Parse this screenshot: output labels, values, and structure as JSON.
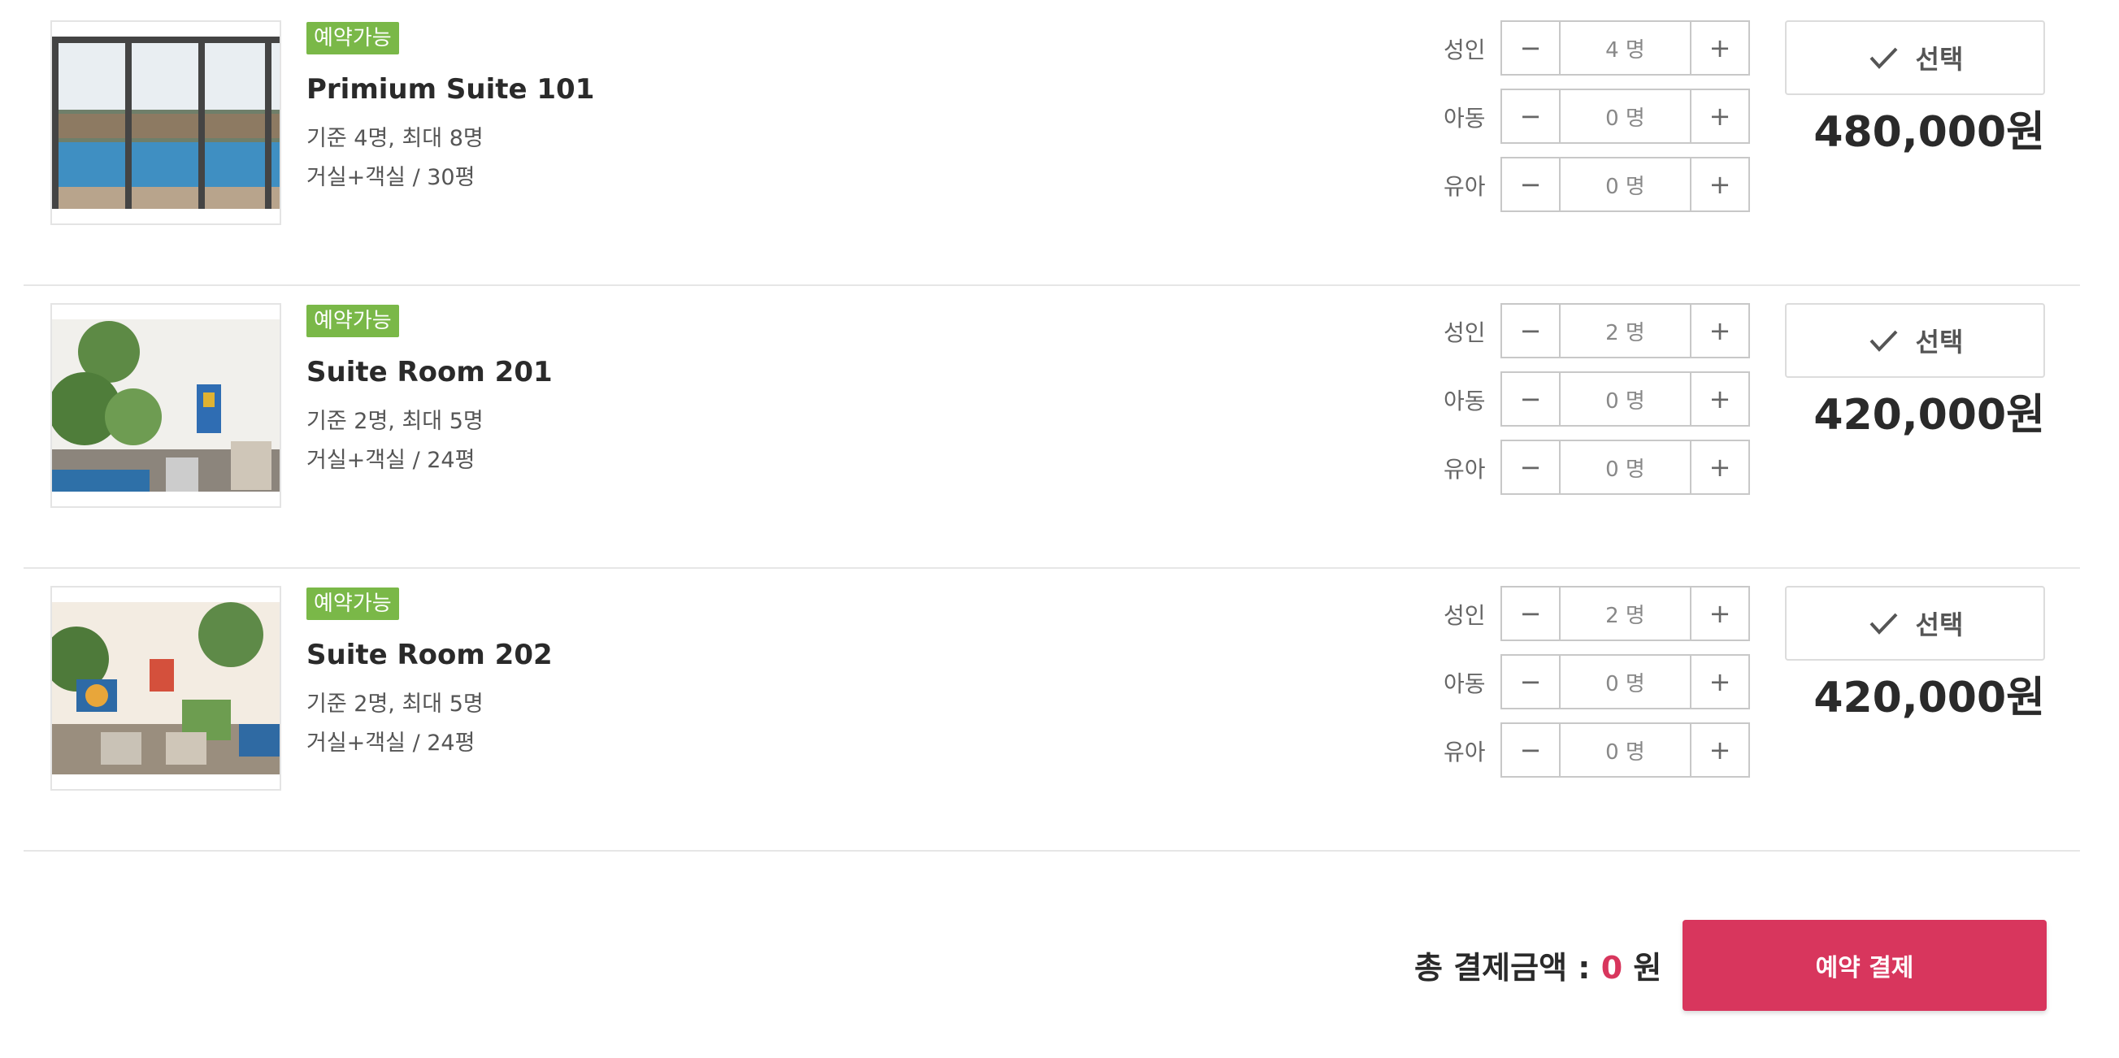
{
  "rooms": [
    {
      "status": "예약가능",
      "name": "Primium Suite 101",
      "capacity": "기준 4명, 최대 8명",
      "size": "거실+객실 / 30평",
      "adult_label": "성인",
      "adult_value": "4 명",
      "child_label": "아동",
      "child_value": "0 명",
      "infant_label": "유아",
      "infant_value": "0 명",
      "select_label": "선택",
      "price": "480,000원"
    },
    {
      "status": "예약가능",
      "name": "Suite Room 201",
      "capacity": "기준 2명, 최대 5명",
      "size": "거실+객실 / 24평",
      "adult_label": "성인",
      "adult_value": "2 명",
      "child_label": "아동",
      "child_value": "0 명",
      "infant_label": "유아",
      "infant_value": "0 명",
      "select_label": "선택",
      "price": "420,000원"
    },
    {
      "status": "예약가능",
      "name": "Suite Room 202",
      "capacity": "기준 2명, 최대 5명",
      "size": "거실+객실 / 24평",
      "adult_label": "성인",
      "adult_value": "2 명",
      "child_label": "아동",
      "child_value": "0 명",
      "infant_label": "유아",
      "infant_value": "0 명",
      "select_label": "선택",
      "price": "420,000원"
    }
  ],
  "stepper": {
    "minus": "−",
    "plus": "+"
  },
  "footer": {
    "total_label": "총 결제금액 : ",
    "total_amount": "0",
    "total_unit": " 원",
    "pay_button": "예약 결제"
  },
  "colors": {
    "badge": "#7ab848",
    "accent": "#d8365d"
  }
}
